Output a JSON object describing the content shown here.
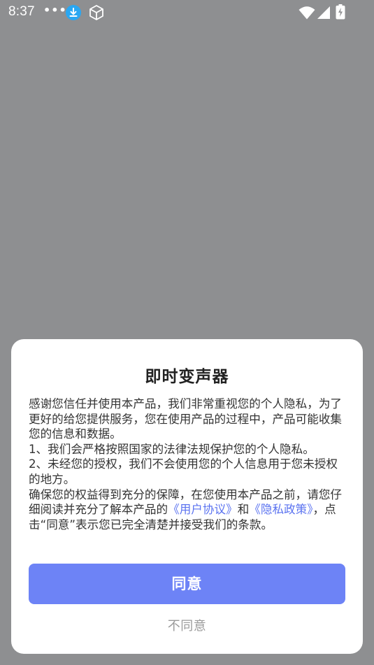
{
  "status_bar": {
    "time": "8:37",
    "dots": "•••",
    "icons": [
      "download-icon",
      "cube-icon",
      "wifi-icon",
      "signal-icon",
      "battery-charging-icon"
    ]
  },
  "dialog": {
    "title": "即时变声器",
    "paragraph_intro": "感谢您信任并使用本产品，我们非常重视您的个人隐私，为了更好的给您提供服务，您在使用产品的过程中，产品可能收集您的信息和数据。",
    "paragraph_1": "1、我们会严格按照国家的法律法规保护您的个人隐私。",
    "paragraph_2": "2、未经您的授权，我们不会使用您的个人信息用于您未授权的地方。",
    "paragraph_3_before": "确保您的权益得到充分的保障，在您使用本产品之前，请您仔细阅读并充分了解本产品的",
    "user_agreement_link": "《用户协议》",
    "conjunction": "和",
    "privacy_policy_link": "《隐私政策》",
    "paragraph_3_after": "，点击“同意”表示您已完全清楚并接受我们的条款。",
    "agree_label": "同意",
    "disagree_label": "不同意"
  },
  "colors": {
    "overlay": "#8e8f91",
    "accent": "#6d83f6",
    "link": "#5b73f0",
    "status_download": "#2aa7f2"
  }
}
